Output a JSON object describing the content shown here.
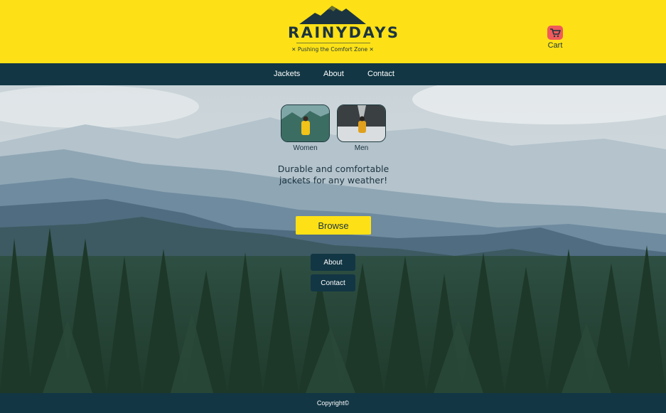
{
  "brand": {
    "title": "RAINYDAYS",
    "tagline": "✕ Pushing the Comfort Zone ✕",
    "logo_icon": "mountain-icon",
    "colors": {
      "yellow": "#fde116",
      "navy": "#123644",
      "cart_red": "#f05a5a"
    }
  },
  "header": {
    "cart_label": "Cart",
    "cart_icon": "cart-icon"
  },
  "nav": {
    "items": [
      {
        "label": "Jackets"
      },
      {
        "label": "About"
      },
      {
        "label": "Contact"
      }
    ]
  },
  "hero": {
    "categories": [
      {
        "label": "Women"
      },
      {
        "label": "Men"
      }
    ],
    "tagline_line1": "Durable and comfortable",
    "tagline_line2": "jackets for any weather!",
    "browse_label": "Browse",
    "about_label": "About",
    "contact_label": "Contact"
  },
  "footer": {
    "copyright": "Copyright©"
  }
}
